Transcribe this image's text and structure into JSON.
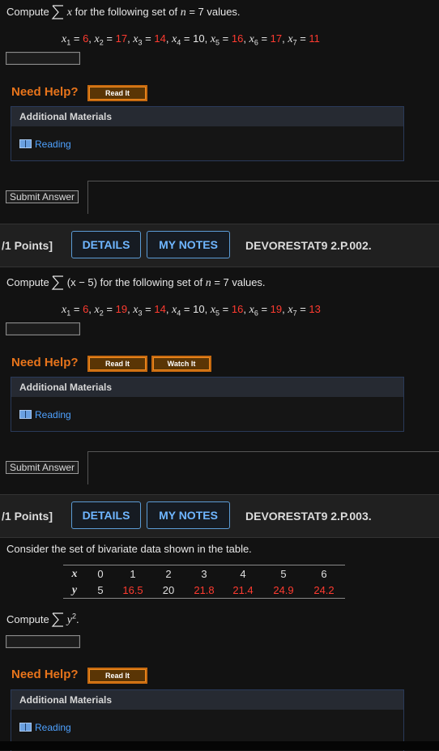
{
  "q1": {
    "prompt_before": "Compute",
    "prompt_var": "x",
    "prompt_after": "for the following set of",
    "n_var": "n",
    "n_value": "= 7 values.",
    "values": [
      {
        "var": "x",
        "sub": "1",
        "val": "6",
        "red": true
      },
      {
        "var": "x",
        "sub": "2",
        "val": "17",
        "red": true
      },
      {
        "var": "x",
        "sub": "3",
        "val": "14",
        "red": true
      },
      {
        "var": "x",
        "sub": "4",
        "val": "10",
        "red": false
      },
      {
        "var": "x",
        "sub": "5",
        "val": "16",
        "red": true
      },
      {
        "var": "x",
        "sub": "6",
        "val": "17",
        "red": true
      },
      {
        "var": "x",
        "sub": "7",
        "val": "11",
        "red": true
      }
    ],
    "answer_value": "",
    "need_help": "Need Help?",
    "help_buttons": [
      "Read It"
    ],
    "materials_title": "Additional Materials",
    "materials_link": "Reading",
    "submit_label": "Submit Answer"
  },
  "q2": {
    "points": "/1 Points]",
    "details_label": "DETAILS",
    "notes_label": "MY NOTES",
    "qid": "DEVORESTAT9 2.P.002.",
    "prompt_before": "Compute",
    "prompt_expr": "(x − 5)",
    "prompt_after": "for the following set of",
    "n_var": "n",
    "n_value": "= 7 values.",
    "values": [
      {
        "var": "x",
        "sub": "1",
        "val": "6",
        "red": true
      },
      {
        "var": "x",
        "sub": "2",
        "val": "19",
        "red": true
      },
      {
        "var": "x",
        "sub": "3",
        "val": "14",
        "red": true
      },
      {
        "var": "x",
        "sub": "4",
        "val": "10",
        "red": false
      },
      {
        "var": "x",
        "sub": "5",
        "val": "16",
        "red": true
      },
      {
        "var": "x",
        "sub": "6",
        "val": "19",
        "red": true
      },
      {
        "var": "x",
        "sub": "7",
        "val": "13",
        "red": true
      }
    ],
    "answer_value": "",
    "need_help": "Need Help?",
    "help_buttons": [
      "Read It",
      "Watch It"
    ],
    "materials_title": "Additional Materials",
    "materials_link": "Reading",
    "submit_label": "Submit Answer"
  },
  "q3": {
    "points": "/1 Points]",
    "details_label": "DETAILS",
    "notes_label": "MY NOTES",
    "qid": "DEVORESTAT9 2.P.003.",
    "prompt": "Consider the set of bivariate data shown in the table.",
    "table": {
      "x_label": "x",
      "y_label": "y",
      "x": [
        "0",
        "1",
        "2",
        "3",
        "4",
        "5",
        "6"
      ],
      "y": [
        "5",
        "16.5",
        "20",
        "21.8",
        "21.4",
        "24.9",
        "24.2"
      ],
      "y_red": [
        false,
        true,
        false,
        true,
        true,
        true,
        true
      ]
    },
    "compute_label": "Compute",
    "compute_var": "y",
    "compute_exp": "2",
    "answer_value": "",
    "need_help": "Need Help?",
    "help_buttons": [
      "Read It"
    ],
    "materials_title": "Additional Materials",
    "materials_link": "Reading"
  },
  "colors": {
    "accent_red": "#ff3b30",
    "need_help_orange": "#e8741b",
    "link_blue": "#4ea1ff",
    "tab_blue": "#6fb6ff"
  }
}
